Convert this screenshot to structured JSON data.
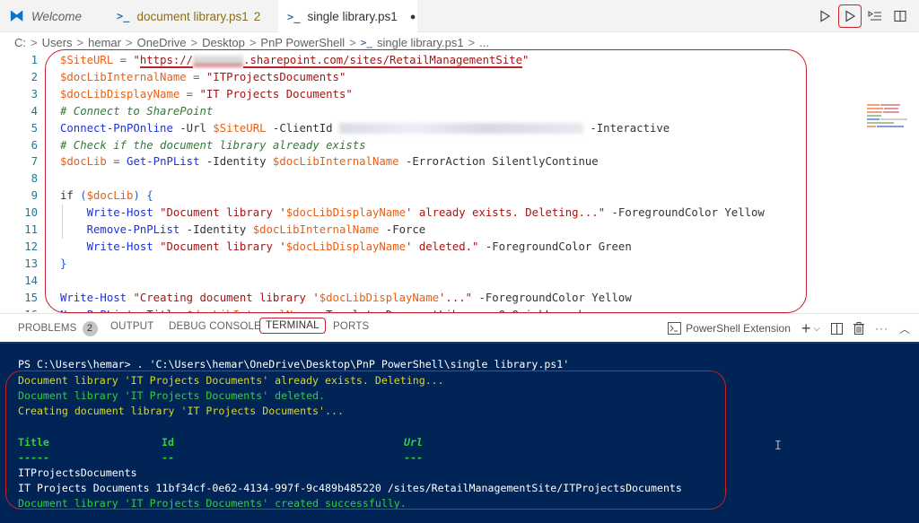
{
  "tabs": [
    {
      "label": "Welcome",
      "icon": "vscode-logo-icon",
      "active": false
    },
    {
      "label": "document library.ps1",
      "badge": "2",
      "icon": "powershell-icon",
      "active": false
    },
    {
      "label": "single library.ps1",
      "modified": "●",
      "icon": "powershell-icon",
      "active": true
    }
  ],
  "toolbar": {
    "run_label": "Run",
    "run_selection_label": "Run Selection",
    "run_lines_label": "Run lines",
    "split_label": "Split Editor"
  },
  "breadcrumb": [
    "C:",
    "Users",
    "hemar",
    "OneDrive",
    "Desktop",
    "PnP PowerShell",
    "single library.ps1",
    "..."
  ],
  "editor": {
    "lines": [
      {
        "n": "1",
        "tokens": [
          [
            "var",
            "$SiteURL"
          ],
          [
            "op",
            " = "
          ],
          [
            "str",
            "\""
          ],
          [
            "strurl",
            "https://"
          ],
          [
            "blursmall",
            ""
          ],
          [
            "strurl",
            ".sharepoint.com/sites/RetailManagementSite"
          ],
          [
            "str",
            "\""
          ]
        ]
      },
      {
        "n": "2",
        "tokens": [
          [
            "var",
            "$docLibInternalName"
          ],
          [
            "op",
            " = "
          ],
          [
            "str",
            "\"ITProjectsDocuments\""
          ]
        ]
      },
      {
        "n": "3",
        "tokens": [
          [
            "var",
            "$docLibDisplayName"
          ],
          [
            "op",
            " = "
          ],
          [
            "str",
            "\"IT Projects Documents\""
          ]
        ]
      },
      {
        "n": "4",
        "tokens": [
          [
            "com",
            "# Connect to SharePoint"
          ]
        ]
      },
      {
        "n": "5",
        "tokens": [
          [
            "cmd",
            "Connect-PnPOnline"
          ],
          [
            "param",
            " -Url "
          ],
          [
            "var",
            "$SiteURL"
          ],
          [
            "param",
            " -ClientId "
          ],
          [
            "blur",
            ""
          ],
          [
            "param",
            " -Interactive"
          ]
        ]
      },
      {
        "n": "6",
        "tokens": [
          [
            "com",
            "# Check if the document library already exists"
          ]
        ]
      },
      {
        "n": "7",
        "tokens": [
          [
            "var",
            "$docLib"
          ],
          [
            "op",
            " = "
          ],
          [
            "cmd",
            "Get-PnPList"
          ],
          [
            "param",
            " -Identity "
          ],
          [
            "var",
            "$docLibInternalName"
          ],
          [
            "param",
            " -ErrorAction SilentlyContinue"
          ]
        ]
      },
      {
        "n": "8",
        "tokens": []
      },
      {
        "n": "9",
        "tokens": [
          [
            "kw",
            "if "
          ],
          [
            "brace",
            "("
          ],
          [
            "var",
            "$docLib"
          ],
          [
            "brace",
            ")"
          ],
          [
            "kw",
            " "
          ],
          [
            "brace",
            "{"
          ]
        ]
      },
      {
        "n": "10",
        "tokens": [
          [
            "kw",
            "    "
          ],
          [
            "cmd",
            "Write-Host"
          ],
          [
            "str",
            " \"Document library '"
          ],
          [
            "var",
            "$docLibDisplayName"
          ],
          [
            "str",
            "' already exists. Deleting...\""
          ],
          [
            "param",
            " -ForegroundColor Yellow"
          ]
        ]
      },
      {
        "n": "11",
        "tokens": [
          [
            "kw",
            "    "
          ],
          [
            "cmd",
            "Remove-PnPList"
          ],
          [
            "param",
            " -Identity "
          ],
          [
            "var",
            "$docLibInternalName"
          ],
          [
            "param",
            " -Force"
          ]
        ]
      },
      {
        "n": "12",
        "tokens": [
          [
            "kw",
            "    "
          ],
          [
            "cmd",
            "Write-Host"
          ],
          [
            "str",
            " \"Document library '"
          ],
          [
            "var",
            "$docLibDisplayName"
          ],
          [
            "str",
            "' deleted.\""
          ],
          [
            "param",
            " -ForegroundColor Green"
          ]
        ]
      },
      {
        "n": "13",
        "tokens": [
          [
            "brace",
            "}"
          ]
        ]
      },
      {
        "n": "14",
        "tokens": []
      },
      {
        "n": "15",
        "tokens": [
          [
            "cmd",
            "Write-Host"
          ],
          [
            "str",
            " \"Creating document library '"
          ],
          [
            "var",
            "$docLibDisplayName"
          ],
          [
            "str",
            "'...\""
          ],
          [
            "param",
            " -ForegroundColor Yellow"
          ]
        ]
      },
      {
        "n": "16",
        "tokens": [
          [
            "cmd",
            "New-PnPList"
          ],
          [
            "param",
            " -Title "
          ],
          [
            "var",
            "$docLibInternalName"
          ],
          [
            "param",
            " -Template DocumentLibrary -OnQuickLaunch"
          ]
        ]
      }
    ]
  },
  "panel": {
    "tabs": [
      {
        "label": "PROBLEMS",
        "badge": "2"
      },
      {
        "label": "OUTPUT"
      },
      {
        "label": "DEBUG CONSOLE"
      },
      {
        "label": "TERMINAL",
        "active": true
      },
      {
        "label": "PORTS"
      }
    ],
    "terminal_name": "PowerShell Extension",
    "actions": [
      "new-terminal",
      "launch-profile",
      "split-terminal",
      "kill-terminal",
      "more-actions",
      "maximize-panel"
    ]
  },
  "terminal": {
    "prompt": "PS C:\\Users\\hemar> . 'C:\\Users\\hemar\\OneDrive\\Desktop\\PnP PowerShell\\single library.ps1'",
    "lines": [
      {
        "text": "Document library 'IT Projects Documents' already exists. Deleting...",
        "color": "yellow"
      },
      {
        "text": "Document library 'IT Projects Documents' deleted.",
        "color": "green"
      },
      {
        "text": "Creating document library 'IT Projects Documents'...",
        "color": "yellow"
      }
    ],
    "table": {
      "headers": [
        "Title",
        "Id",
        "Url"
      ],
      "underlines": [
        "-----",
        "--",
        "---"
      ],
      "rows": [
        "ITProjectsDocuments",
        "IT Projects Documents 11bf34cf-0e62-4134-997f-9c489b485220 /sites/RetailManagementSite/ITProjectsDocuments"
      ]
    },
    "final": "Document library 'IT Projects Documents' created successfully."
  },
  "colors": {
    "annotation": "#c0202a",
    "terminal_bg": "#012456",
    "terminal_yellow": "#d7d72a",
    "terminal_green": "#2fd13a"
  }
}
